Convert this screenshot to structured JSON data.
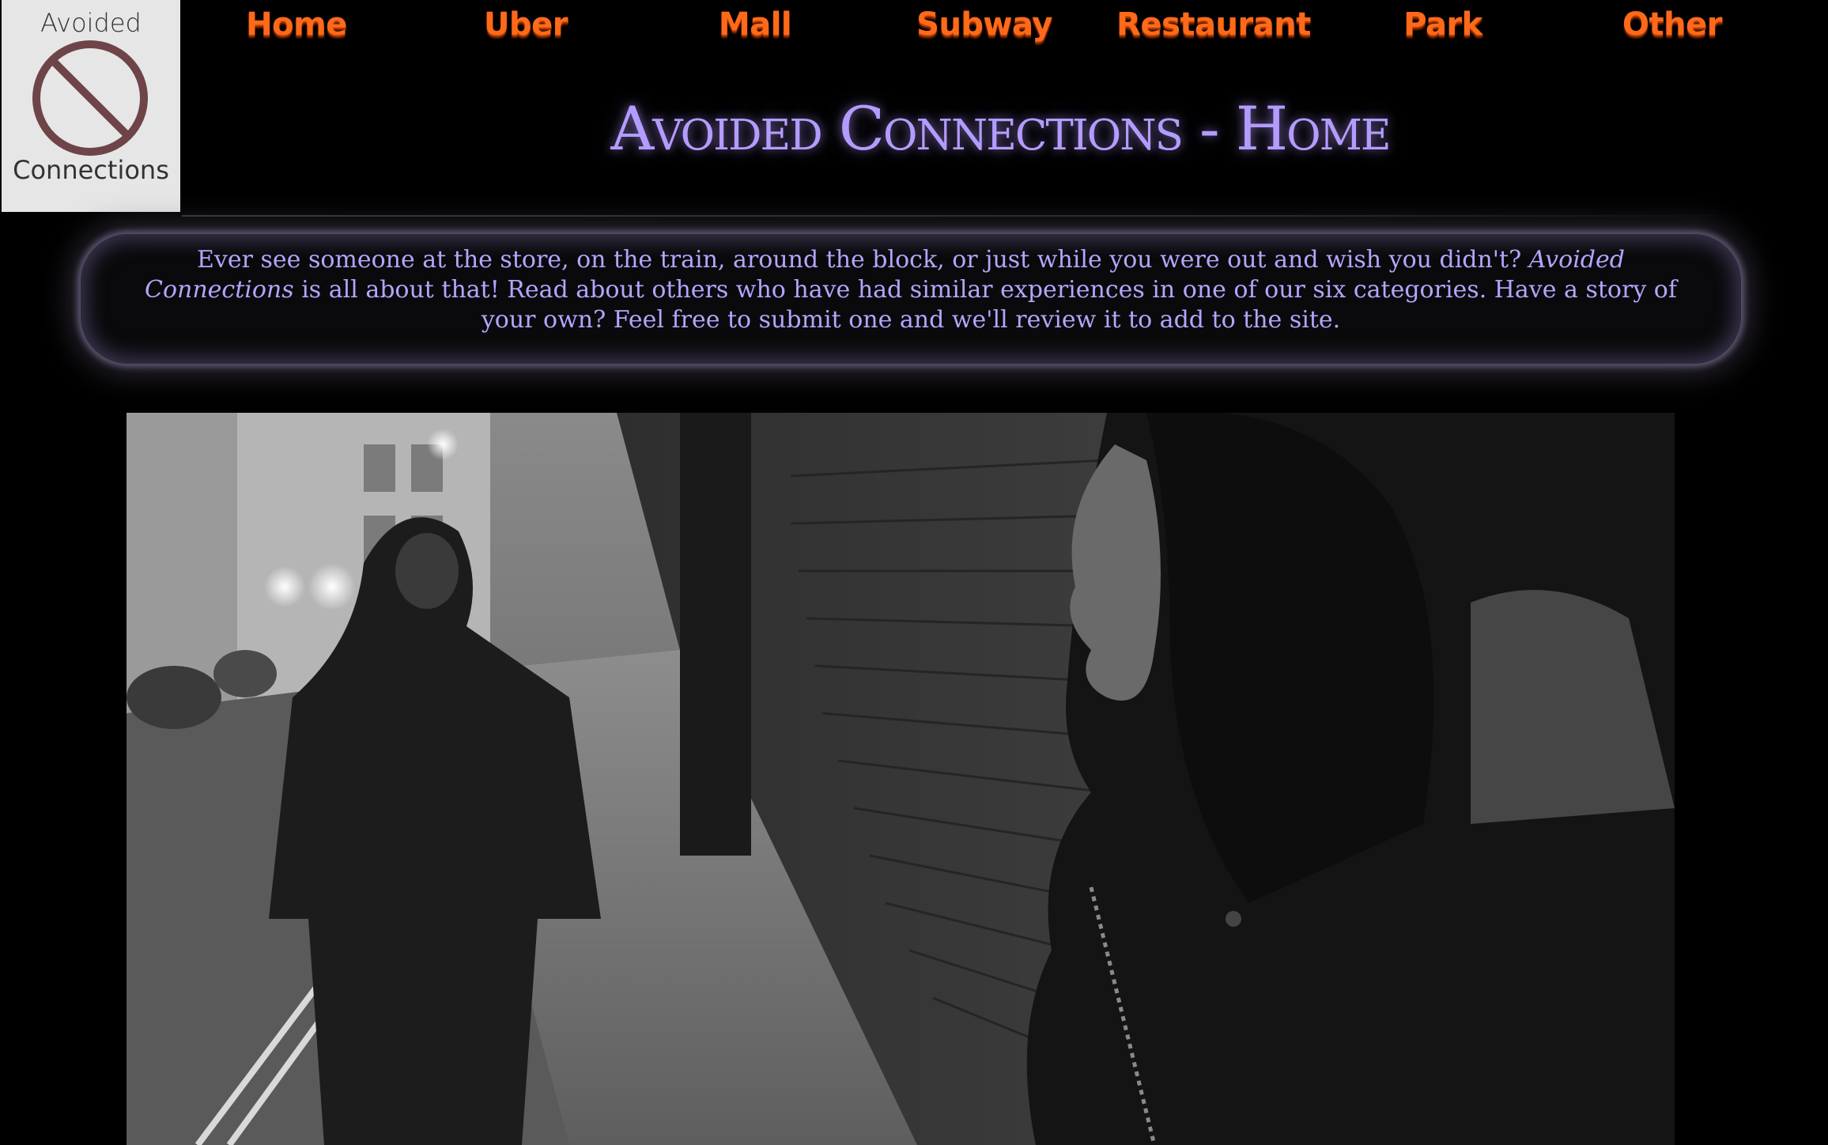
{
  "logo": {
    "line1": "Avoided",
    "line2": "Connections",
    "icon": "prohibited-icon",
    "icon_color": "#6e4448"
  },
  "nav": {
    "items": [
      {
        "label": "Home"
      },
      {
        "label": "Uber"
      },
      {
        "label": "Mall"
      },
      {
        "label": "Subway"
      },
      {
        "label": "Restaurant"
      },
      {
        "label": "Park"
      },
      {
        "label": "Other"
      }
    ],
    "color": "#ff6a1a"
  },
  "header": {
    "title": "Avoided Connections - Home",
    "title_color": "#b49cff"
  },
  "intro": {
    "text_before": "Ever see someone at the store, on the train, around the block, or just while you were out and wish you didn't? ",
    "emphasis": "Avoided Connections",
    "text_after": " is all about that! Read about others who have had similar experiences in one of our six categories. Have a story of your own? Feel free to submit one and we'll review it to add to the site."
  },
  "hero_image": {
    "icon": "hero-photo"
  },
  "colors": {
    "background": "#000000",
    "intro_text": "#b7a4ff",
    "glow": "#5e5670"
  }
}
